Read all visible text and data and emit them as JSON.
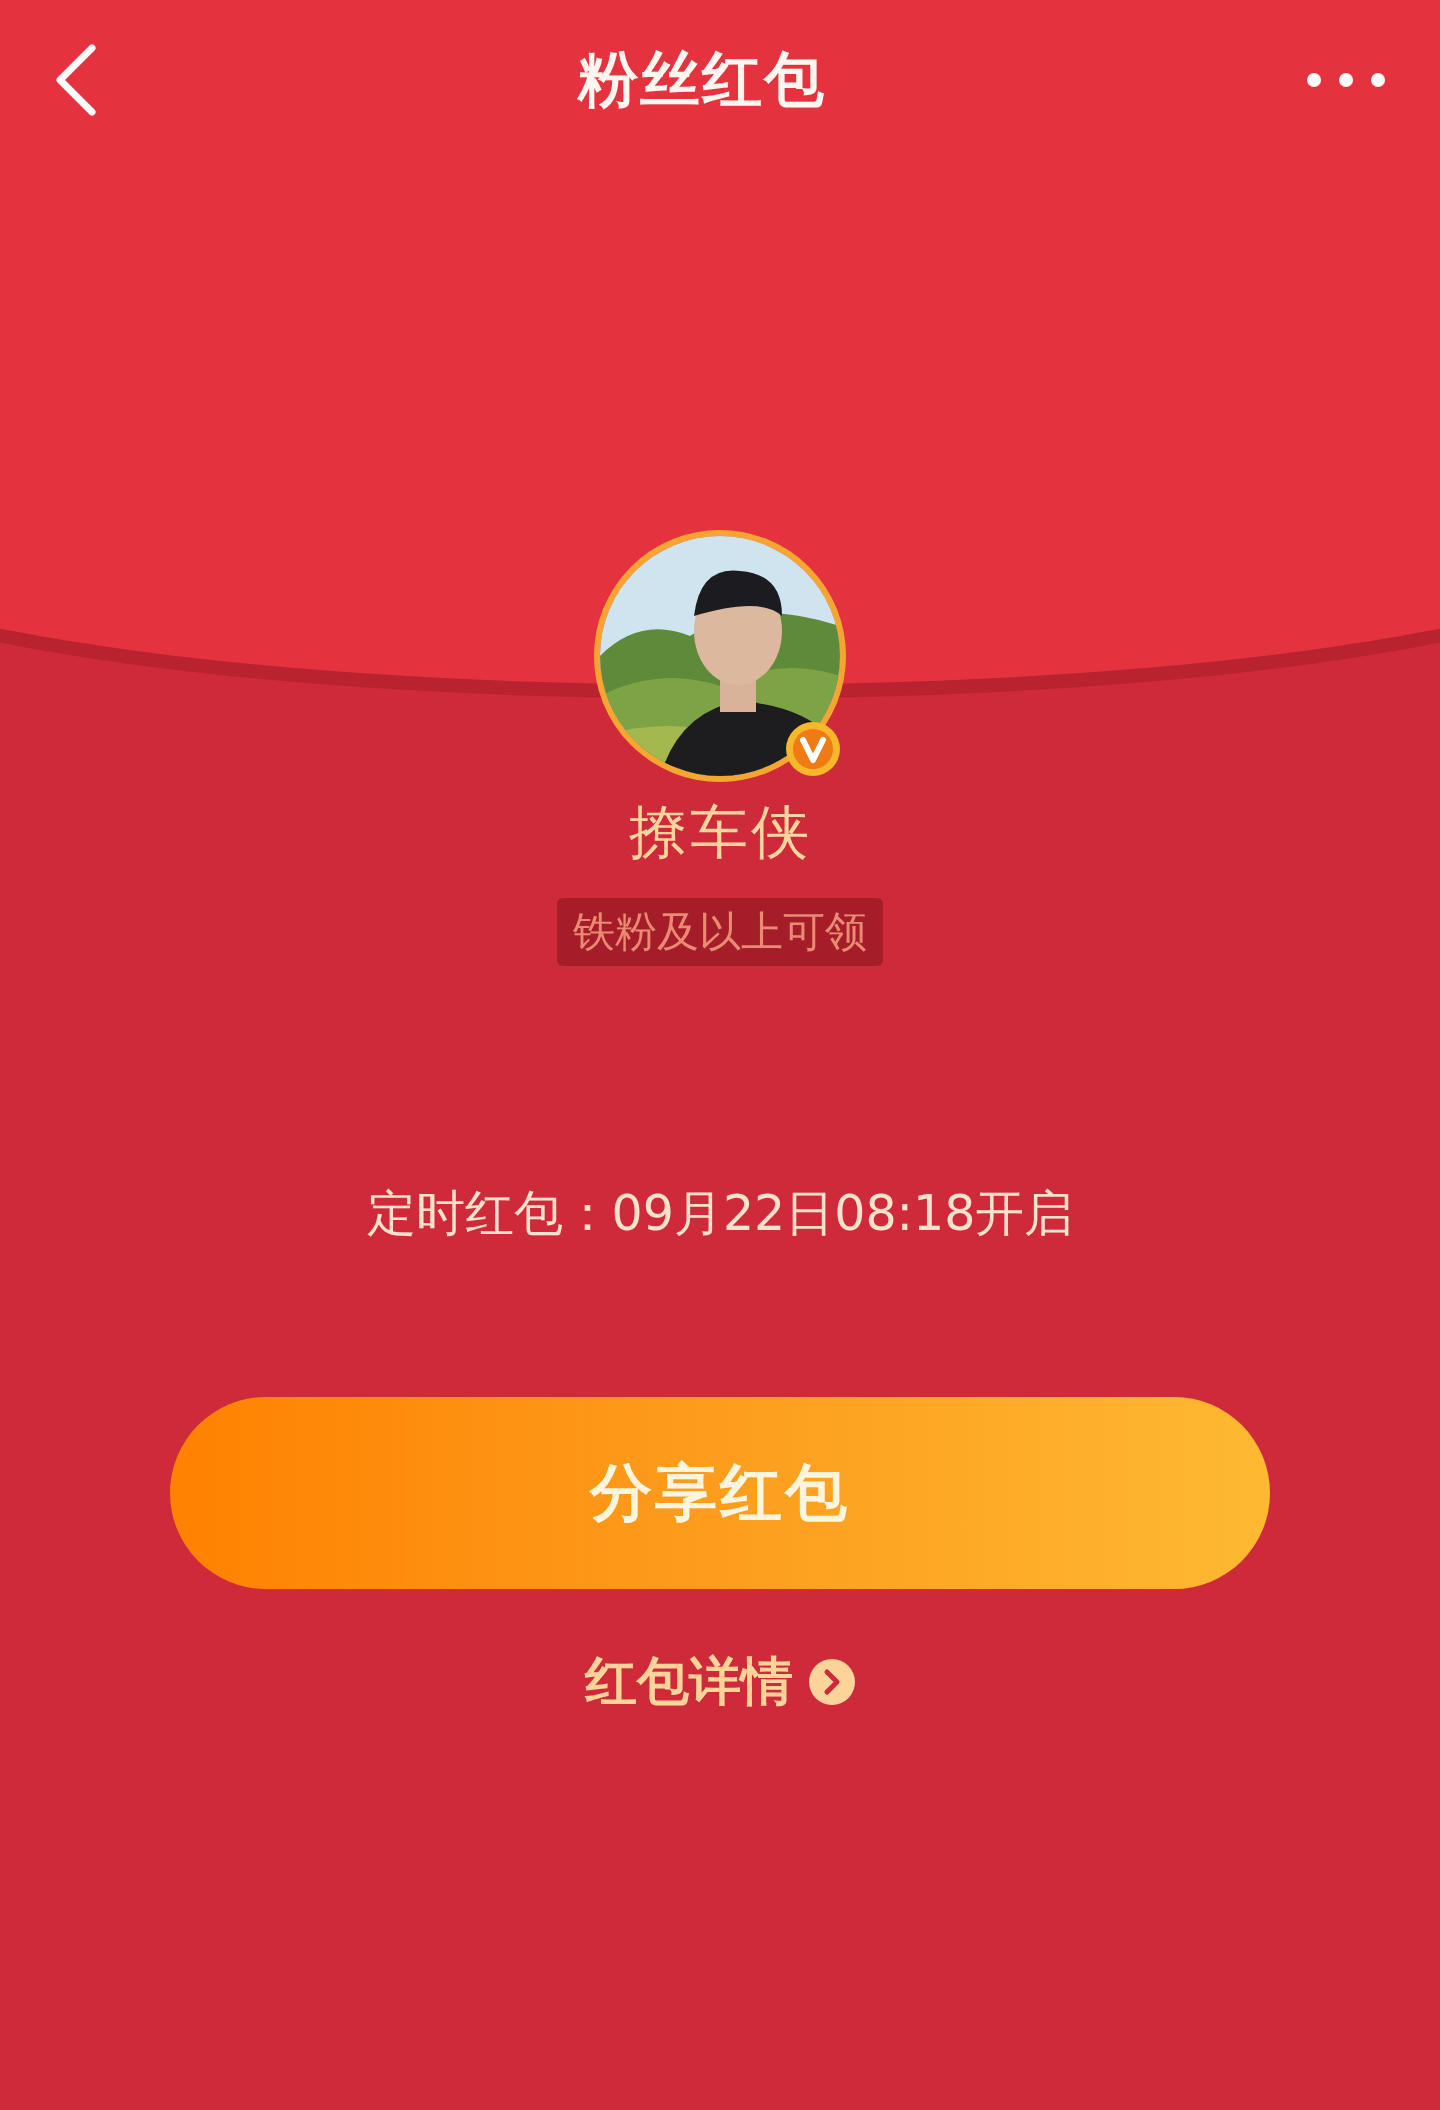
{
  "header": {
    "title": "粉丝红包"
  },
  "sender": {
    "verified": true,
    "name": "撩车侠",
    "eligibility": "铁粉及以上可领"
  },
  "schedule": "定时红包：09月22日08:18开启",
  "share_button": {
    "label": "分享红包"
  },
  "details_link": {
    "label": "红包详情"
  }
}
